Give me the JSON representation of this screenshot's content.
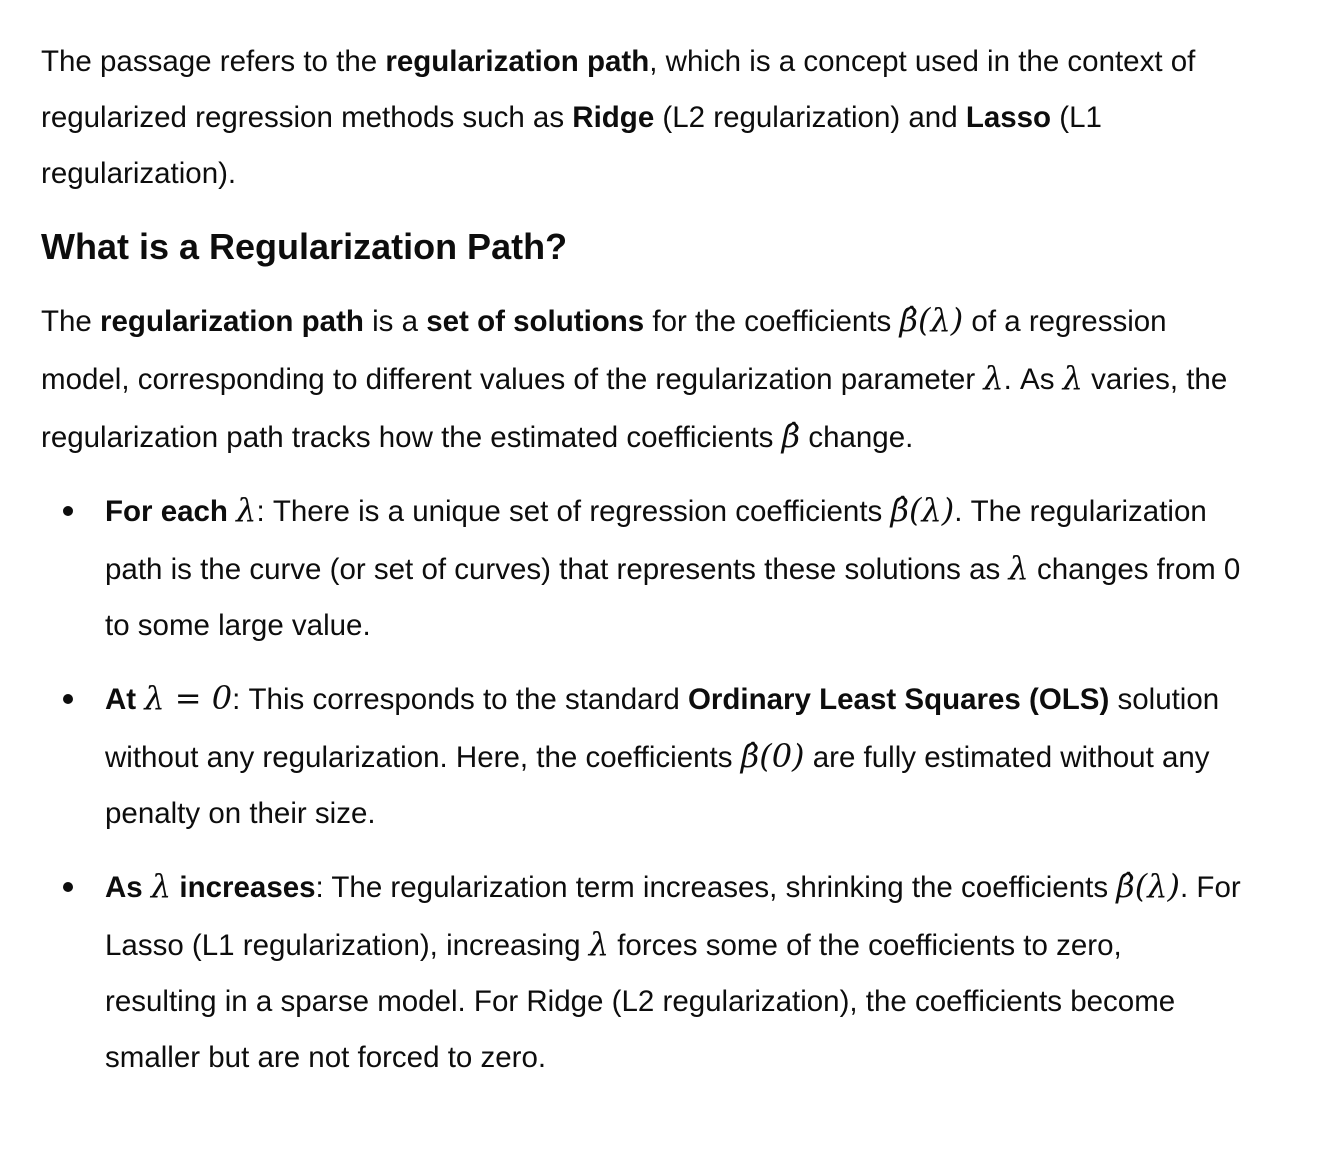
{
  "intro": {
    "t1": "The passage refers to the ",
    "b1": "regularization path",
    "t2": ", which is a concept used in the context of regularized regression methods such as ",
    "b2": "Ridge",
    "t3": " (L2 regularization) and ",
    "b3": "Lasso",
    "t4": " (L1 regularization)."
  },
  "heading": "What is a Regularization Path?",
  "definition": {
    "t1": "The ",
    "b1": "regularization path",
    "t2": " is a ",
    "b2": "set of solutions",
    "t3": " for the coefficients ",
    "m1": "β̂(λ)",
    "t4": " of a regression model, corresponding to different values of the regularization parameter ",
    "m2": "λ",
    "t5": ". As ",
    "m3": "λ",
    "t6": " varies, the regularization path tracks how the estimated coefficients ",
    "m4": "β̂",
    "t7": " change."
  },
  "bullets": [
    {
      "b1": "For each ",
      "m1": "λ",
      "t1": ": There is a unique set of regression coefficients ",
      "m2": "β̂(λ)",
      "t2": ". The regularization path is the curve (or set of curves) that represents these solutions as ",
      "m3": "λ",
      "t3": " changes from 0 to some large value."
    },
    {
      "b1": "At ",
      "m1": "λ = 0",
      "t1": ": This corresponds to the standard ",
      "b2": "Ordinary Least Squares (OLS)",
      "t2": " solution without any regularization. Here, the coefficients ",
      "m2": "β̂(0)",
      "t3": " are fully estimated without any penalty on their size."
    },
    {
      "b1": "As ",
      "m1": "λ",
      "b2": " increases",
      "t1": ": The regularization term increases, shrinking the coefficients ",
      "m2": "β̂(λ)",
      "t2": ". For Lasso (L1 regularization), increasing ",
      "m3": "λ",
      "t3": " forces some of the coefficients to zero, resulting in a sparse model. For Ridge (L2 regularization), the coefficients become smaller but are not forced to zero."
    }
  ]
}
